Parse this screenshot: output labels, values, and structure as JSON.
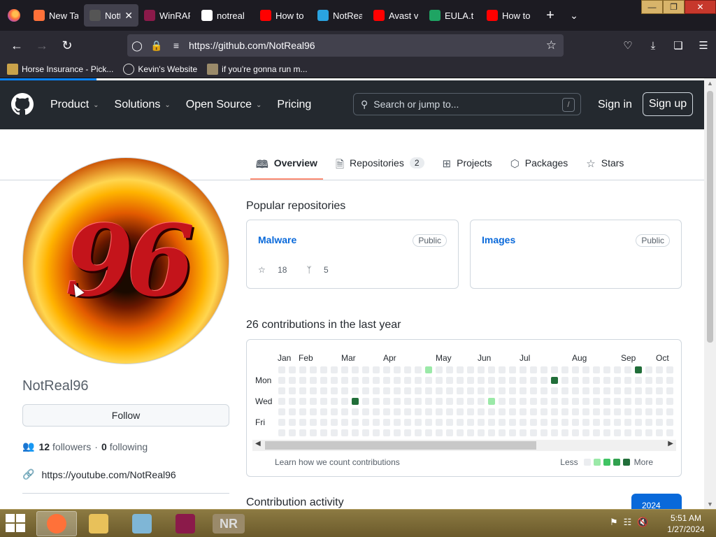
{
  "browser": {
    "tabs": [
      {
        "label": "New Ta",
        "icon": "firefox-icon",
        "color": "#ff7139",
        "active": false
      },
      {
        "label": "Nott",
        "icon": "github-icon",
        "color": "#555555",
        "active": true
      },
      {
        "label": "WinRAR",
        "icon": "winrar-icon",
        "color": "#8b1a4a",
        "active": false
      },
      {
        "label": "notreal",
        "icon": "google-icon",
        "color": "#ffffff",
        "active": false
      },
      {
        "label": "How to",
        "icon": "youtube-icon",
        "color": "#ff0000",
        "active": false
      },
      {
        "label": "NotRea",
        "icon": "telegram-icon",
        "color": "#2aa3e0",
        "active": false
      },
      {
        "label": "Avast v",
        "icon": "youtube-icon",
        "color": "#ff0000",
        "active": false
      },
      {
        "label": "EULA.t",
        "icon": "google-drive-icon",
        "color": "#1fa463",
        "active": false
      },
      {
        "label": "How to",
        "icon": "youtube-icon",
        "color": "#ff0000",
        "active": false
      }
    ],
    "url": "https://github.com/NotReal96",
    "bookmarks": [
      {
        "label": "Horse Insurance - Pick...",
        "icon": "bookmark-icon",
        "color": "#c9a24a"
      },
      {
        "label": "Kevin's Website",
        "icon": "globe-icon",
        "color": "#dddddd"
      },
      {
        "label": "if you're gonna run m...",
        "icon": "face-icon",
        "color": "#9a8a6a"
      }
    ]
  },
  "github": {
    "nav": [
      "Product",
      "Solutions",
      "Open Source",
      "Pricing"
    ],
    "search_placeholder": "Search or jump to...",
    "search_shortcut": "/",
    "sign_in": "Sign in",
    "sign_up": "Sign up",
    "tabs": [
      {
        "label": "Overview",
        "icon": "book-icon",
        "count": ""
      },
      {
        "label": "Repositories",
        "icon": "repo-icon",
        "count": "2"
      },
      {
        "label": "Projects",
        "icon": "table-icon",
        "count": ""
      },
      {
        "label": "Packages",
        "icon": "package-icon",
        "count": ""
      },
      {
        "label": "Stars",
        "icon": "star-icon",
        "count": ""
      }
    ],
    "profile": {
      "avatar_text": "96",
      "username": "NotReal96",
      "follow": "Follow",
      "followers_count": "12",
      "followers_label": "followers",
      "following_count": "0",
      "following_label": "following",
      "link": "https://youtube.com/NotReal96"
    },
    "popular_title": "Popular repositories",
    "repos": [
      {
        "name": "Malware",
        "visibility": "Public",
        "stars": "18",
        "forks": "5"
      },
      {
        "name": "Images",
        "visibility": "Public",
        "stars": "",
        "forks": ""
      }
    ],
    "contributions": {
      "title": "26 contributions in the last year",
      "months": [
        "Jan",
        "Feb",
        "Mar",
        "Apr",
        "May",
        "Jun",
        "Jul",
        "Aug",
        "Sep",
        "Oct"
      ],
      "days": [
        "Mon",
        "Wed",
        "Fri"
      ],
      "learn": "Learn how we count contributions",
      "less": "Less",
      "more": "More",
      "levels": [
        "#ebedf0",
        "#9be9a8",
        "#40c463",
        "#30a14e",
        "#216e39"
      ]
    },
    "activity_title": "Contribution activity",
    "year": "2024"
  },
  "taskbar": {
    "apps": [
      {
        "name": "firefox",
        "color": "#ff7139",
        "active": true
      },
      {
        "name": "file-explorer",
        "color": "#e8c15a",
        "active": false
      },
      {
        "name": "notepad",
        "color": "#7fb6d6",
        "active": false
      },
      {
        "name": "winrar",
        "color": "#8b1a4a",
        "active": false
      },
      {
        "name": "nr",
        "color": "#9a8a6a",
        "active": false
      }
    ],
    "nr_label": "NR",
    "time": "5:51 AM",
    "date": "1/27/2024"
  }
}
